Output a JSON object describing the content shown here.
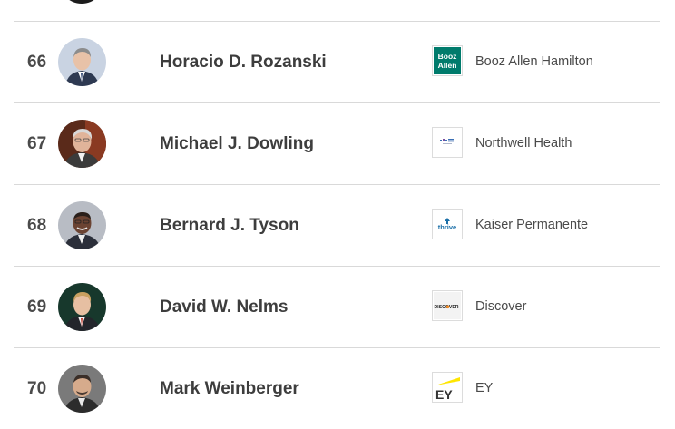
{
  "rows": [
    {
      "rank": "66",
      "name": "Horacio D. Rozanski",
      "company": "Booz Allen Hamilton",
      "logo_text": [
        "Booz",
        "Allen"
      ],
      "logo_icon": "booz-allen-logo"
    },
    {
      "rank": "67",
      "name": "Michael J. Dowling",
      "company": "Northwell Health",
      "logo_icon": "northwell-logo"
    },
    {
      "rank": "68",
      "name": "Bernard J. Tyson",
      "company": "Kaiser Permanente",
      "logo_text": [
        "thrive"
      ],
      "logo_icon": "kaiser-thrive-logo"
    },
    {
      "rank": "69",
      "name": "David W. Nelms",
      "company": "Discover",
      "logo_text": [
        "DISCOVER"
      ],
      "logo_icon": "discover-logo"
    },
    {
      "rank": "70",
      "name": "Mark Weinberger",
      "company": "EY",
      "logo_text": [
        "EY"
      ],
      "logo_icon": "ey-logo"
    }
  ],
  "colors": {
    "booz_allen_bg": "#007b6c",
    "ey_yellow": "#ffe600",
    "divider": "#d9d9d9",
    "rank_text": "#4a4a4a"
  }
}
